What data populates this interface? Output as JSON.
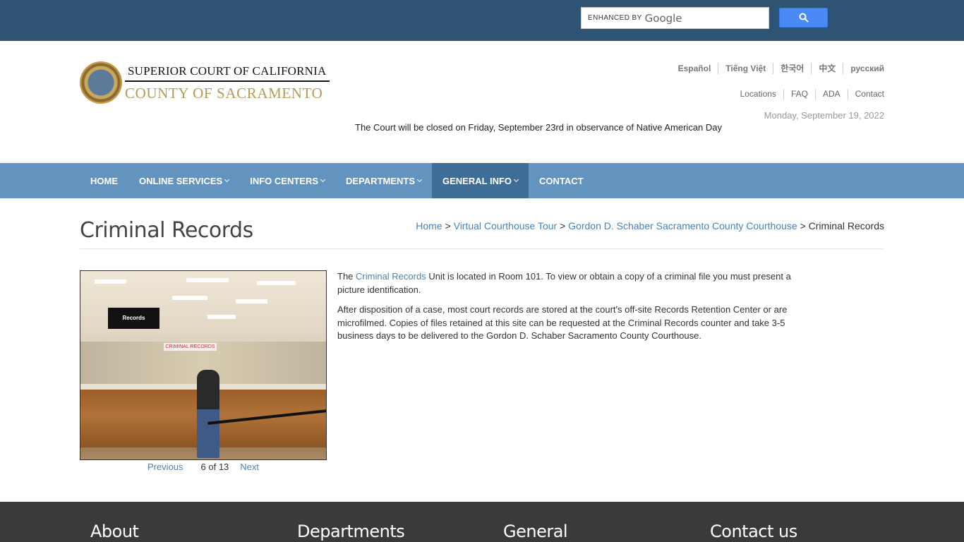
{
  "search": {
    "enhanced_label": "ENHANCED BY",
    "google_label": "Google",
    "button_icon": "search-icon",
    "button_color": "#4a8af4"
  },
  "logo": {
    "line1": "SUPERIOR COURT OF CALIFORNIA",
    "line2": "COUNTY OF SACRAMENTO",
    "seal_icon": "county-seal-icon"
  },
  "languages": [
    "Español",
    "Tiếng Việt",
    "한국어",
    "中文",
    "русский"
  ],
  "utility_links": [
    "Locations",
    "FAQ",
    "ADA",
    "Contact"
  ],
  "date": "Monday, September 19, 2022",
  "notice": "The Court will be closed on Friday, September 23rd in observance of Native American Day",
  "nav": {
    "items": [
      {
        "label": "HOME",
        "dropdown": false
      },
      {
        "label": "ONLINE SERVICES",
        "dropdown": true
      },
      {
        "label": "INFO CENTERS",
        "dropdown": true
      },
      {
        "label": "DEPARTMENTS",
        "dropdown": true
      },
      {
        "label": "GENERAL INFO",
        "dropdown": true,
        "active": true
      },
      {
        "label": "CONTACT",
        "dropdown": false
      }
    ]
  },
  "page": {
    "title": "Criminal Records",
    "breadcrumb": [
      {
        "label": "Home",
        "link": true
      },
      {
        "label": "Virtual Courthouse Tour",
        "link": true
      },
      {
        "label": "Gordon D. Schaber Sacramento County Courthouse",
        "link": true
      },
      {
        "label": "Criminal Records",
        "link": false
      }
    ],
    "separator": ">"
  },
  "gallery": {
    "sign_text": "Records",
    "caption_text": "CRIMINAL RECORDS",
    "previous_label": "Previous",
    "count_label": "6 of 13",
    "next_label": "Next",
    "current": 6,
    "total": 13
  },
  "body": {
    "p1_before": "The ",
    "p1_link": "Criminal Records",
    "p1_after": " Unit is located in Room 101. To view or obtain a copy of a criminal file you must present a picture identification.",
    "p2": "After disposition of a case, most court records are stored at the court's off-site Records Retention Center or are microfilmed. Copies of files retained at this site can be requested at the Criminal Records counter and take 3-5 business days to be delivered to the Gordon D. Schaber Sacramento County Courthouse."
  },
  "footer": {
    "headings": [
      "About",
      "Departments",
      "General",
      "Contact us"
    ]
  },
  "colors": {
    "topbar": "#2f5373",
    "nav": "#6394bf",
    "nav_active": "#3e6e98",
    "link": "#4a82b5",
    "logo_gold": "#b89a55",
    "footer": "#3a3a3a"
  }
}
